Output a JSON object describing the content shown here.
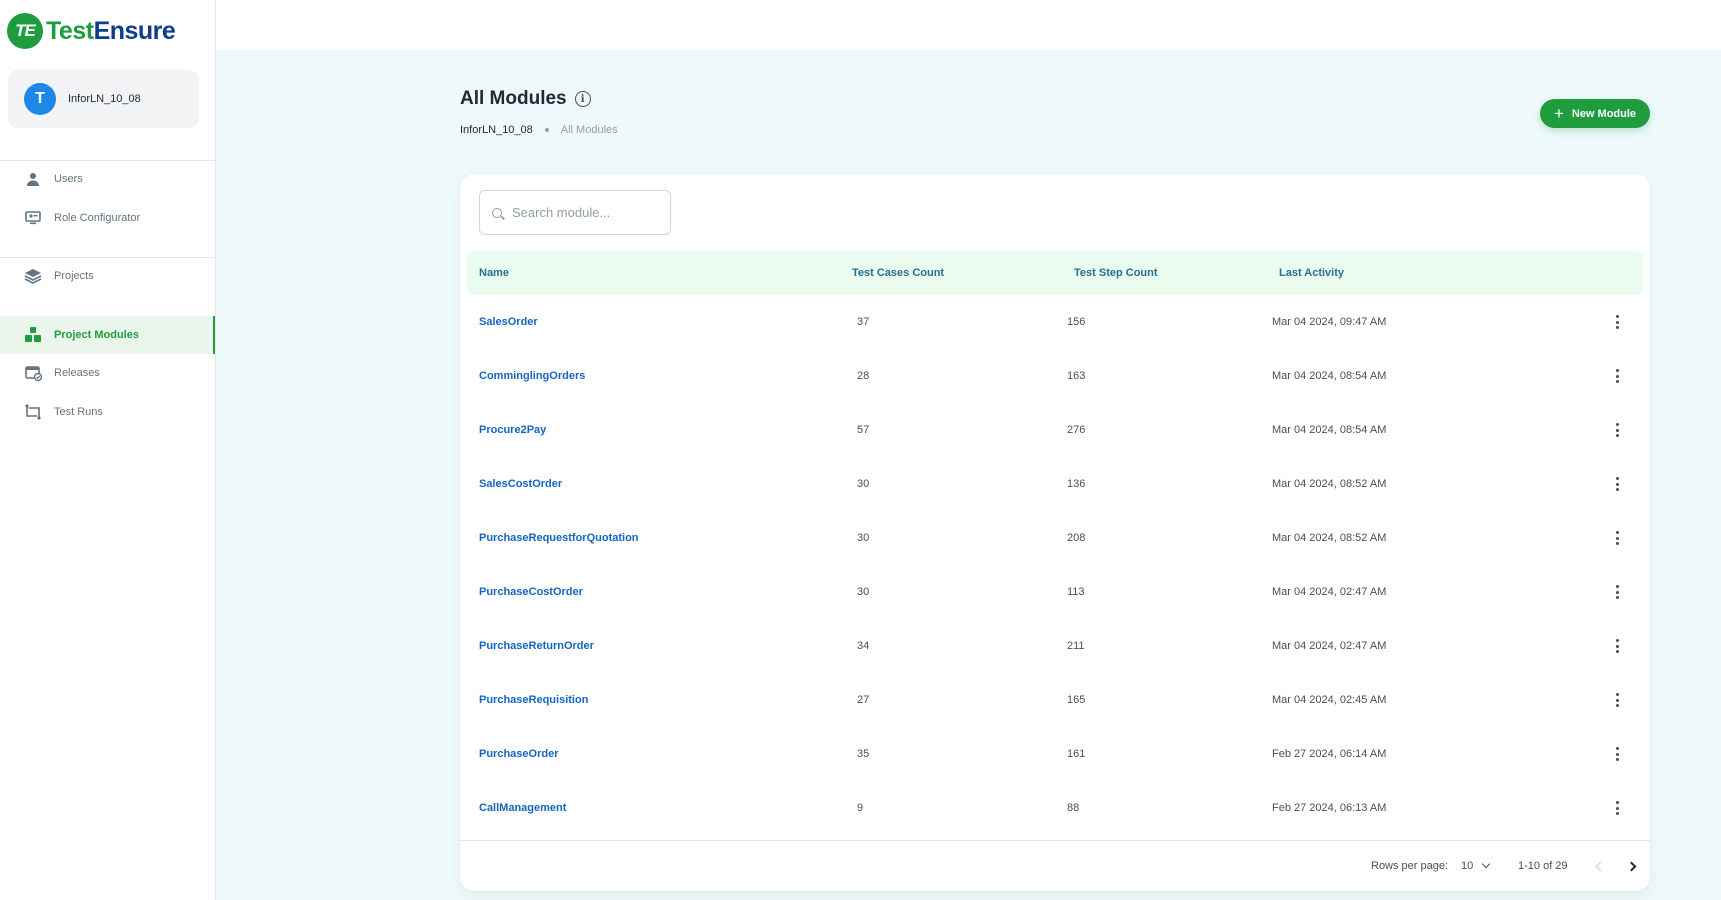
{
  "brand": {
    "logo_mark": "TE",
    "name_part1": "Test",
    "name_part2": "Ensure",
    "primary_color": "#1f9d3e",
    "secondary_color": "#0f3d8c"
  },
  "account": {
    "avatar_letter": "T",
    "name": "InforLN_10_08"
  },
  "sidebar": {
    "items": [
      {
        "label": "Users",
        "icon": "user-icon"
      },
      {
        "label": "Role Configurator",
        "icon": "monitor-user-icon"
      },
      {
        "label": "Projects",
        "icon": "layers-icon"
      },
      {
        "label": "Project Modules",
        "icon": "blocks-icon",
        "active": true
      },
      {
        "label": "Releases",
        "icon": "calendar-check-icon"
      },
      {
        "label": "Test Runs",
        "icon": "flow-icon"
      }
    ]
  },
  "header": {
    "title": "All Modules",
    "breadcrumb": [
      "InforLN_10_08",
      "All Modules"
    ],
    "new_button_label": "New Module"
  },
  "search": {
    "placeholder": "Search module...",
    "value": ""
  },
  "table": {
    "columns": [
      "Name",
      "Test Cases Count",
      "Test Step Count",
      "Last Activity"
    ],
    "rows": [
      {
        "name": "SalesOrder",
        "cases": "37",
        "steps": "156",
        "last": "Mar 04 2024, 09:47 AM"
      },
      {
        "name": "ComminglingOrders",
        "cases": "28",
        "steps": "163",
        "last": "Mar 04 2024, 08:54 AM"
      },
      {
        "name": "Procure2Pay",
        "cases": "57",
        "steps": "276",
        "last": "Mar 04 2024, 08:54 AM"
      },
      {
        "name": "SalesCostOrder",
        "cases": "30",
        "steps": "136",
        "last": "Mar 04 2024, 08:52 AM"
      },
      {
        "name": "PurchaseRequestforQuotation",
        "cases": "30",
        "steps": "208",
        "last": "Mar 04 2024, 08:52 AM"
      },
      {
        "name": "PurchaseCostOrder",
        "cases": "30",
        "steps": "113",
        "last": "Mar 04 2024, 02:47 AM"
      },
      {
        "name": "PurchaseReturnOrder",
        "cases": "34",
        "steps": "211",
        "last": "Mar 04 2024, 02:47 AM"
      },
      {
        "name": "PurchaseRequisition",
        "cases": "27",
        "steps": "165",
        "last": "Mar 04 2024, 02:45 AM"
      },
      {
        "name": "PurchaseOrder",
        "cases": "35",
        "steps": "161",
        "last": "Feb 27 2024, 06:14 AM"
      },
      {
        "name": "CallManagement",
        "cases": "9",
        "steps": "88",
        "last": "Feb 27 2024, 06:13 AM"
      }
    ]
  },
  "pagination": {
    "rows_label": "Rows per page:",
    "rows_value": "10",
    "range": "1-10 of 29"
  }
}
